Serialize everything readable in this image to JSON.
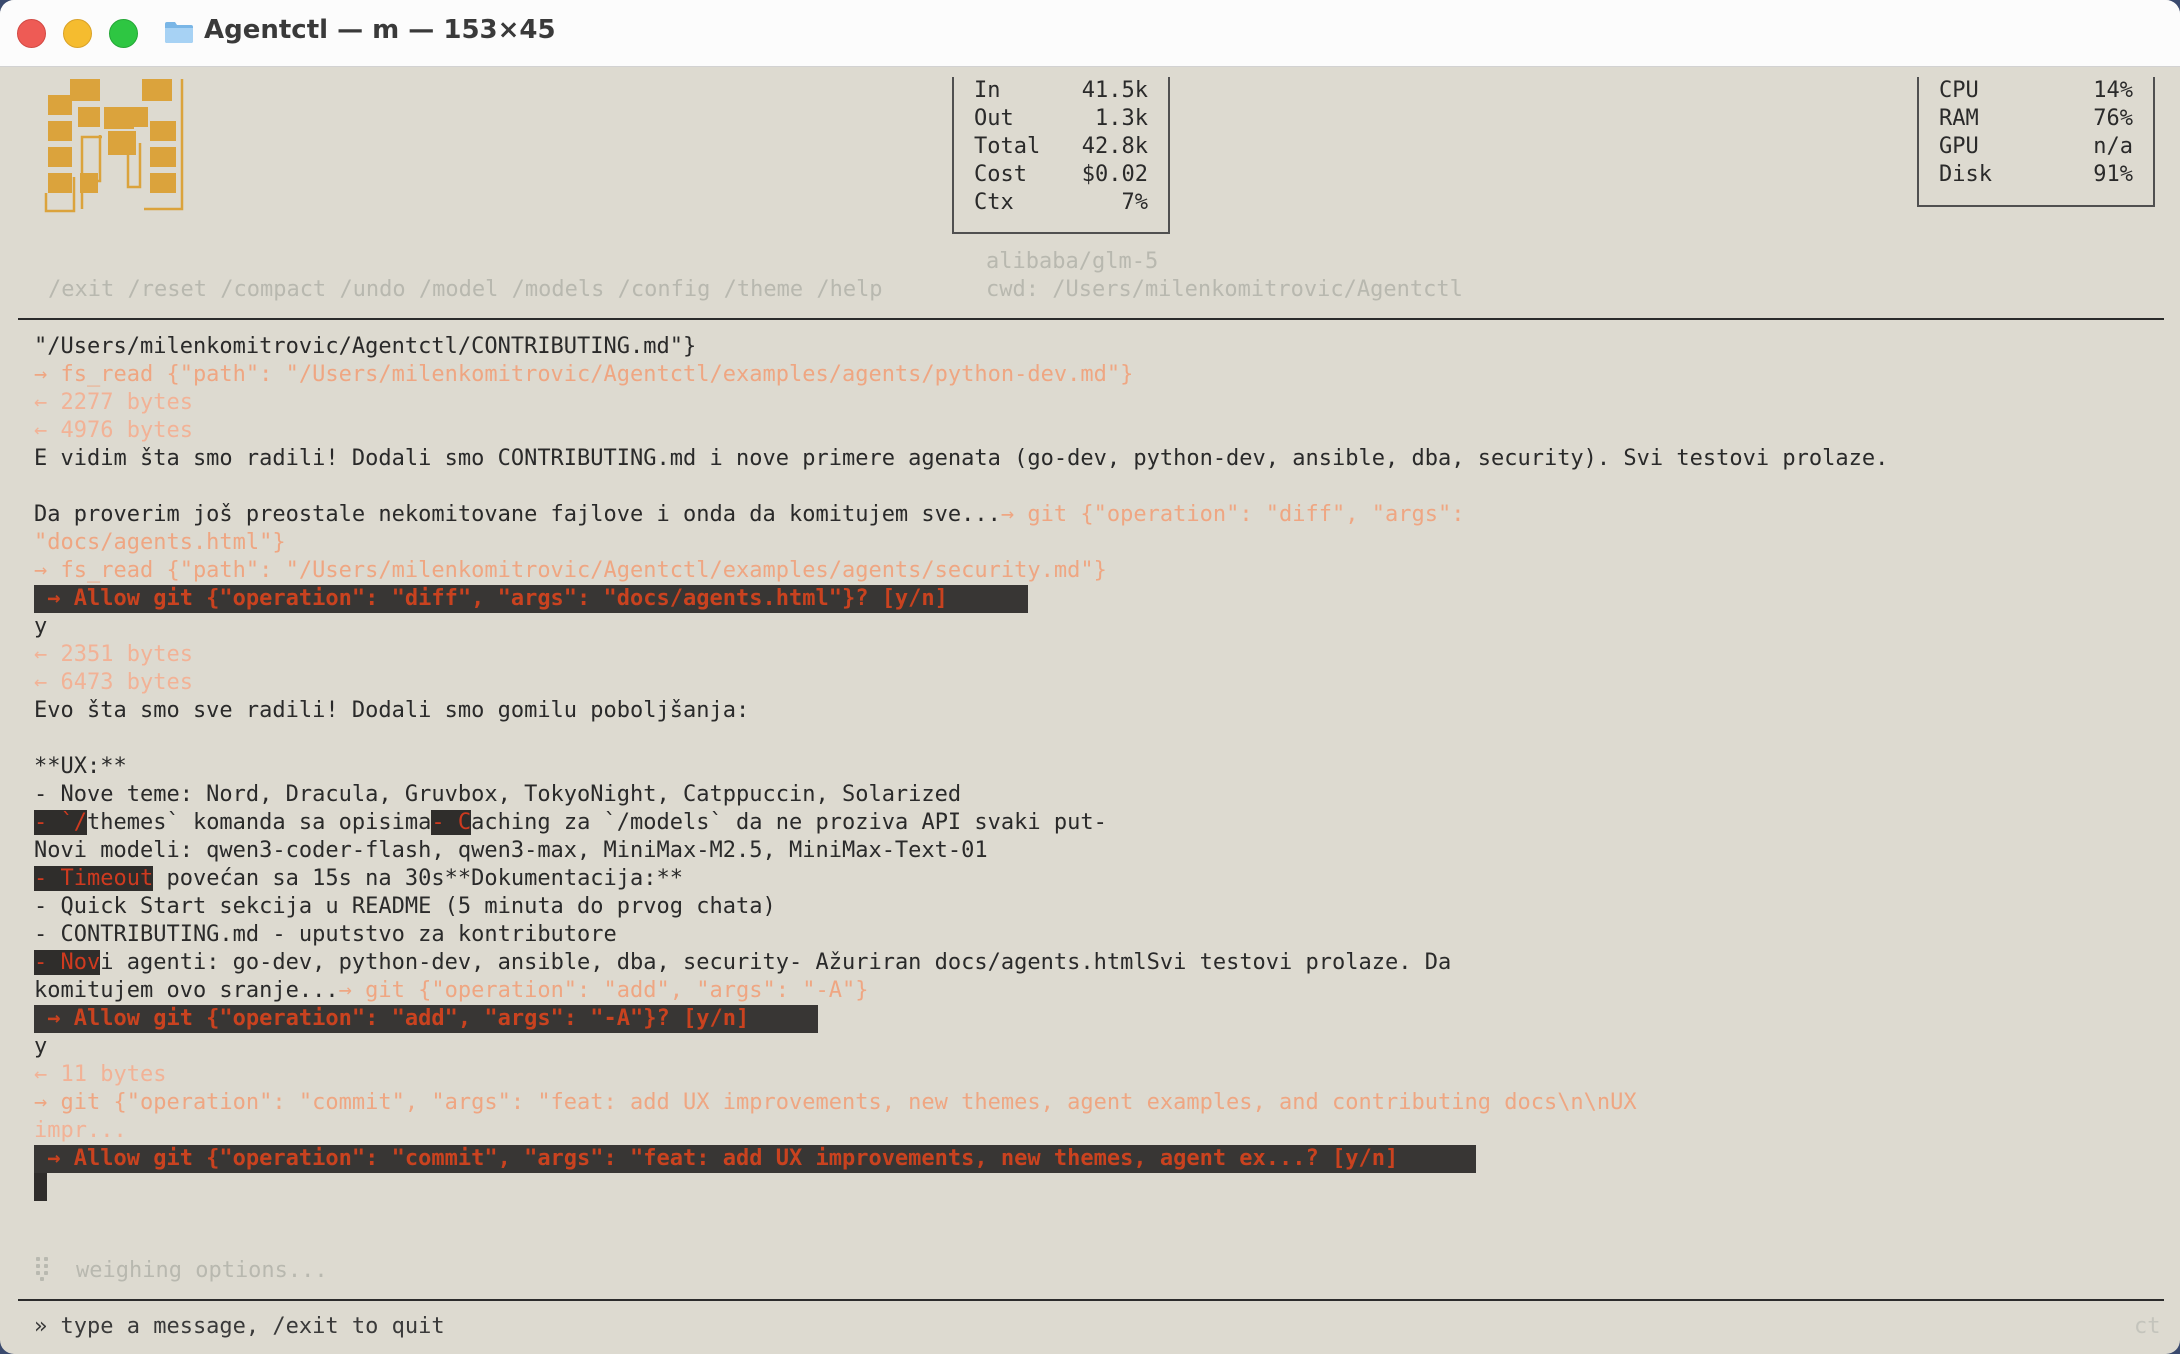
{
  "window": {
    "title": "Agentctl — m — 153×45",
    "buttons": {
      "close": "×",
      "minimize": "−",
      "zoom": "+"
    }
  },
  "header": {
    "usage": [
      {
        "label": "In",
        "value": "41.5k"
      },
      {
        "label": "Out",
        "value": "1.3k"
      },
      {
        "label": "Total",
        "value": "42.8k"
      },
      {
        "label": "Cost",
        "value": "$0.02"
      },
      {
        "label": "Ctx",
        "value": "7%"
      }
    ],
    "system": [
      {
        "label": "CPU",
        "value": "14%"
      },
      {
        "label": "RAM",
        "value": "76%"
      },
      {
        "label": "GPU",
        "value": "n/a"
      },
      {
        "label": "Disk",
        "value": "91%"
      }
    ],
    "model": "alibaba/glm-5",
    "cwd": "cwd: /Users/milenkomitrovic/Agentctl",
    "commands": [
      "/exit",
      "/reset",
      "/compact",
      "/undo",
      "/model",
      "/models",
      "/config",
      "/theme",
      "/help"
    ]
  },
  "transcript": {
    "l01": "\"/Users/milenkomitrovic/Agentctl/CONTRIBUTING.md\"}",
    "l02": "→ fs_read {\"path\": \"/Users/milenkomitrovic/Agentctl/examples/agents/python-dev.md\"}",
    "l03": "← 2277 bytes",
    "l04": "← 4976 bytes",
    "l05": "E vidim šta smo radili! Dodali smo CONTRIBUTING.md i nove primere agenata (go-dev, python-dev, ansible, dba, security). Svi testovi prolaze.",
    "l07a": "Da proverim još preostale nekomitovane fajlove i onda da komitujem sve...",
    "l07b": "→ git {\"operation\": \"diff\", \"args\":",
    "l08": "\"docs/agents.html\"}",
    "l09": "→ fs_read {\"path\": \"/Users/milenkomitrovic/Agentctl/examples/agents/security.md\"}",
    "l10": " → Allow git {\"operation\": \"diff\", \"args\": \"docs/agents.html\"}? [y/n] ",
    "l11": "y",
    "l12": "← 2351 bytes",
    "l13": "← 6473 bytes",
    "l14": "Evo šta smo sve radili! Dodali smo gomilu poboljšanja:",
    "l16": "**UX:**",
    "l17": "- Nove teme: Nord, Dracula, Gruvbox, TokyoNight, Catppuccin, Solarized",
    "l18a": "- `/",
    "l18b": "themes` komanda sa opisima",
    "l18c": "- C",
    "l18d": "aching za `/models` da ne proziva API svaki put-",
    "l19": "Novi modeli: qwen3-coder-flash, qwen3-max, MiniMax-M2.5, MiniMax-Text-01",
    "l20a": "- Timeout",
    "l20b": " povećan sa 15s na 30s**Dokumentacija:**",
    "l21": "- Quick Start sekcija u README (5 minuta do prvog chata)",
    "l22": "- CONTRIBUTING.md - uputstvo za kontributore",
    "l23a": "- Nov",
    "l23b": "i agenti: go-dev, python-dev, ansible, dba, security- Ažuriran docs/agents.htmlSvi testovi prolaze. Da",
    "l24a": "komitujem ovo sranje...",
    "l24b": "→ git {\"operation\": \"add\", \"args\": \"-A\"}",
    "l25": " → Allow git {\"operation\": \"add\", \"args\": \"-A\"}? [y/n] ",
    "l26": "y",
    "l27": "← 11 bytes",
    "l28": "→ git {\"operation\": \"commit\", \"args\": \"feat: add UX improvements, new themes, agent examples, and contributing docs\\n\\nUX",
    "l29": "impr...",
    "l30": " → Allow git {\"operation\": \"commit\", \"args\": \"feat: add UX improvements, new themes, agent ex...? [y/n]"
  },
  "status": {
    "spinner_text": "weighing options..."
  },
  "input": {
    "placeholder": "» type a message, /exit to quit",
    "corner": "ct"
  }
}
